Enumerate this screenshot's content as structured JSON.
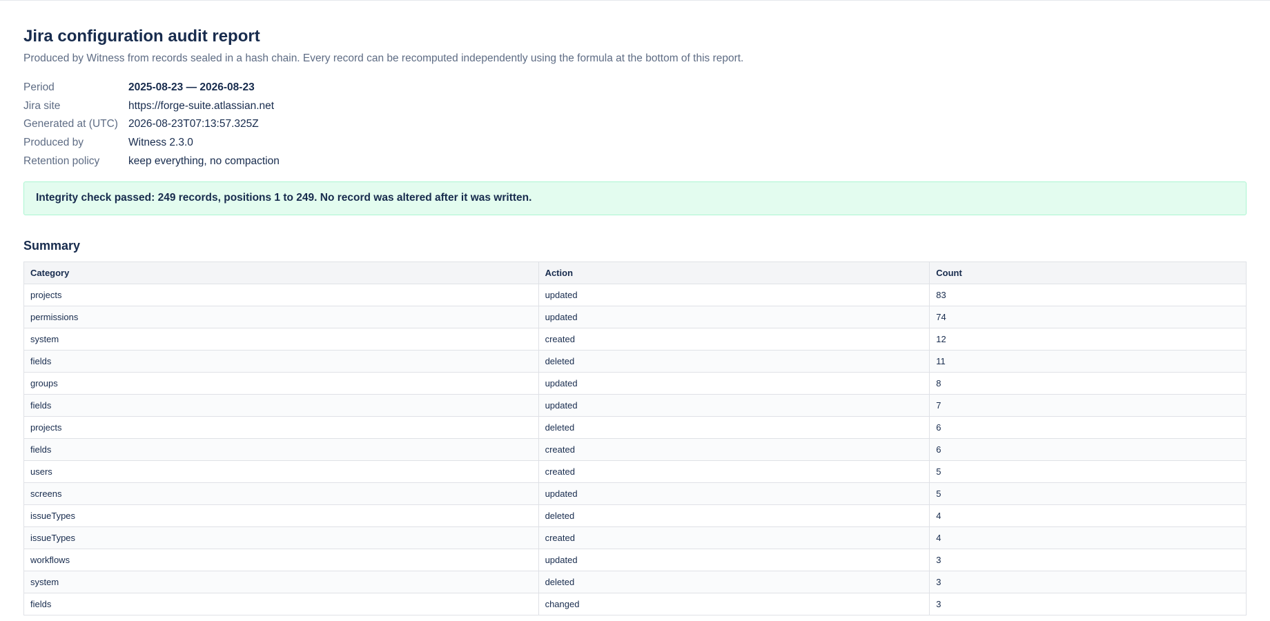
{
  "report": {
    "title": "Jira configuration audit report",
    "subtitle": "Produced by Witness from records sealed in a hash chain. Every record can be recomputed independently using the formula at the bottom of this report."
  },
  "meta": {
    "period_label": "Period",
    "period_value": "2025-08-23 — 2026-08-23",
    "site_label": "Jira site",
    "site_value": "https://forge-suite.atlassian.net",
    "generated_label": "Generated at (UTC)",
    "generated_value": "2026-08-23T07:13:57.325Z",
    "produced_label": "Produced by",
    "produced_value": "Witness 2.3.0",
    "retention_label": "Retention policy",
    "retention_value": "keep everything, no compaction"
  },
  "integrity": {
    "message": "Integrity check passed: 249 records, positions 1 to 249. No record was altered after it was written.",
    "status_color": "#e3fcef"
  },
  "summary": {
    "heading": "Summary",
    "columns": [
      "Category",
      "Action",
      "Count"
    ],
    "rows": [
      [
        "projects",
        "updated",
        "83"
      ],
      [
        "permissions",
        "updated",
        "74"
      ],
      [
        "system",
        "created",
        "12"
      ],
      [
        "fields",
        "deleted",
        "11"
      ],
      [
        "groups",
        "updated",
        "8"
      ],
      [
        "fields",
        "updated",
        "7"
      ],
      [
        "projects",
        "deleted",
        "6"
      ],
      [
        "fields",
        "created",
        "6"
      ],
      [
        "users",
        "created",
        "5"
      ],
      [
        "screens",
        "updated",
        "5"
      ],
      [
        "issueTypes",
        "deleted",
        "4"
      ],
      [
        "issueTypes",
        "created",
        "4"
      ],
      [
        "workflows",
        "updated",
        "3"
      ],
      [
        "system",
        "deleted",
        "3"
      ],
      [
        "fields",
        "changed",
        "3"
      ]
    ]
  }
}
